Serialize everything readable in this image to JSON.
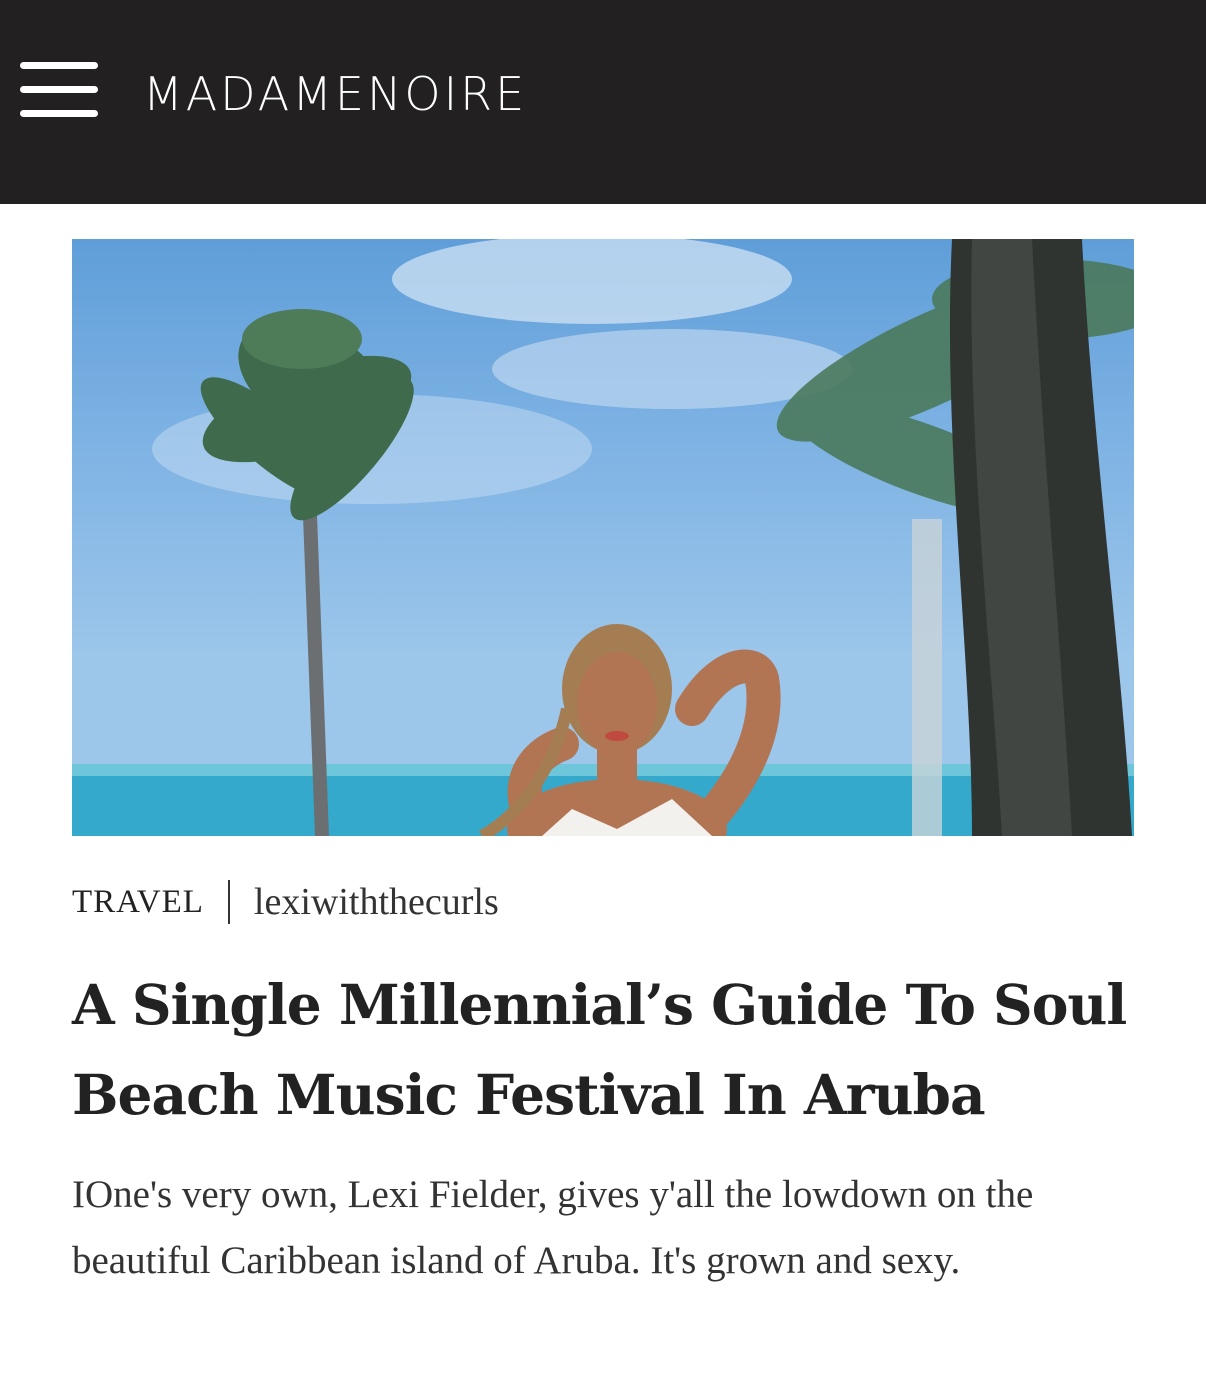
{
  "header": {
    "logo_text": "MADAMENOIRE",
    "menu_icon": "hamburger-menu-icon",
    "background_color": "#222020"
  },
  "hero_image": {
    "description_icon": "beach-photo"
  },
  "article": {
    "category": "TRAVEL",
    "author": "lexiwiththecurls",
    "headline": "A Single Millennial’s Guide To Soul Beach Music Festival In Aruba",
    "dek": "IOne's very own, Lexi Fielder, gives y'all the lowdown on the beautiful Caribbean island of Aruba. It's grown and sexy."
  }
}
